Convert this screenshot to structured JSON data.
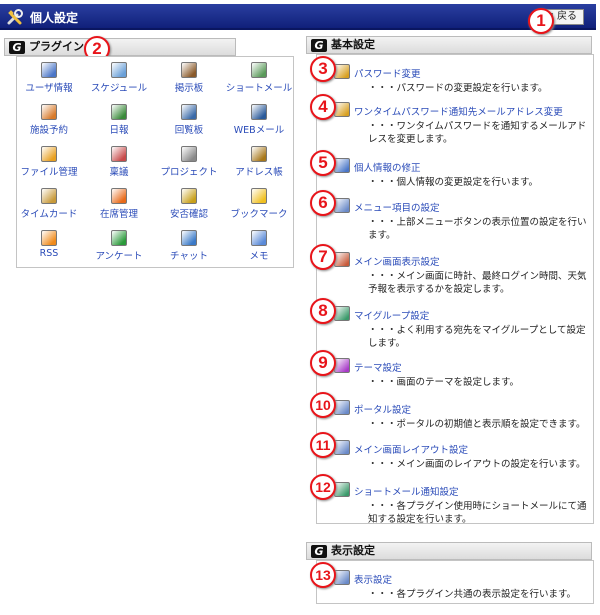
{
  "header": {
    "title": "個人設定",
    "back_label": "戻る"
  },
  "plugin_section": {
    "title": "プラグイン"
  },
  "plugins": [
    {
      "label": "ユーザ情報",
      "icon": "user-info-icon",
      "color": "#4a76c8"
    },
    {
      "label": "スケジュール",
      "icon": "schedule-icon",
      "color": "#6aa0d8"
    },
    {
      "label": "掲示板",
      "icon": "bulletin-board-icon",
      "color": "#8a5a2a"
    },
    {
      "label": "ショートメール",
      "icon": "short-mail-icon",
      "color": "#5a9a5a"
    },
    {
      "label": "施設予約",
      "icon": "facility-icon",
      "color": "#d87a2a"
    },
    {
      "label": "日報",
      "icon": "daily-report-icon",
      "color": "#3a8a3a"
    },
    {
      "label": "回覧板",
      "icon": "circular-icon",
      "color": "#3a6aa8"
    },
    {
      "label": "WEBメール",
      "icon": "webmail-icon",
      "color": "#2a5a9a"
    },
    {
      "label": "ファイル管理",
      "icon": "folder-icon",
      "color": "#e8a020"
    },
    {
      "label": "稟議",
      "icon": "approval-icon",
      "color": "#c84a4a"
    },
    {
      "label": "プロジェクト",
      "icon": "project-icon",
      "color": "#888888"
    },
    {
      "label": "アドレス帳",
      "icon": "address-book-icon",
      "color": "#a8781a"
    },
    {
      "label": "タイムカード",
      "icon": "clock-icon",
      "color": "#c89a3a"
    },
    {
      "label": "在席管理",
      "icon": "presence-icon",
      "color": "#e86a1a"
    },
    {
      "label": "安否確認",
      "icon": "safety-icon",
      "color": "#c8a01a"
    },
    {
      "label": "ブックマーク",
      "icon": "bookmark-star-icon",
      "color": "#f0c020"
    },
    {
      "label": "RSS",
      "icon": "rss-icon",
      "color": "#f08a1a"
    },
    {
      "label": "アンケート",
      "icon": "survey-check-icon",
      "color": "#2a9a3a"
    },
    {
      "label": "チャット",
      "icon": "chat-icon",
      "color": "#3a7ac8"
    },
    {
      "label": "メモ",
      "icon": "memo-icon",
      "color": "#5a8ad8"
    }
  ],
  "basic_section": {
    "title": "基本設定"
  },
  "basic_items": [
    {
      "number": "3",
      "label": "パスワード変更",
      "desc": "・・・パスワードの変更設定を行います。",
      "icon": "lock-icon",
      "color": "#d8a020"
    },
    {
      "number": "4",
      "label": "ワンタイムパスワード通知先メールアドレス変更",
      "desc": "・・・ワンタイムパスワードを通知するメールアドレスを変更します。",
      "icon": "lock-mail-icon",
      "color": "#d8a020"
    },
    {
      "number": "5",
      "label": "個人情報の修正",
      "desc": "・・・個人情報の変更設定を行います。",
      "icon": "user-edit-icon",
      "color": "#4a76c8"
    },
    {
      "number": "6",
      "label": "メニュー項目の設定",
      "desc": "・・・上部メニューボタンの表示位置の設定を行います。",
      "icon": "menu-settings-icon",
      "color": "#6a8ac8"
    },
    {
      "number": "7",
      "label": "メイン画面表示設定",
      "desc": "・・・メイン画面に時計、最終ログイン時間、天気予報を表示するかを設定します。",
      "icon": "main-display-icon",
      "color": "#c85a3a"
    },
    {
      "number": "8",
      "label": "マイグループ設定",
      "desc": "・・・よく利用する宛先をマイグループとして設定します。",
      "icon": "my-group-icon",
      "color": "#3a9a6a"
    },
    {
      "number": "9",
      "label": "テーマ設定",
      "desc": "・・・画面のテーマを設定します。",
      "icon": "theme-icon",
      "color": "#a83ac8"
    },
    {
      "number": "10",
      "label": "ポータル設定",
      "desc": "・・・ポータルの初期値と表示順を設定できます。",
      "icon": "portal-icon",
      "color": "#6a8ac8"
    },
    {
      "number": "11",
      "label": "メイン画面レイアウト設定",
      "desc": "・・・メイン画面のレイアウトの設定を行います。",
      "icon": "layout-icon",
      "color": "#6a8ac8"
    },
    {
      "number": "12",
      "label": "ショートメール通知設定",
      "desc": "・・・各プラグイン使用時にショートメールにて通知する設定を行います。",
      "icon": "mail-notify-icon",
      "color": "#3a9a6a"
    }
  ],
  "display_section": {
    "title": "表示設定"
  },
  "display_items": [
    {
      "number": "13",
      "label": "表示設定",
      "desc": "・・・各プラグイン共通の表示設定を行います。",
      "icon": "display-settings-icon",
      "color": "#6a8ac8"
    }
  ],
  "markers": {
    "back": "1",
    "plugins": "2"
  },
  "colors": {
    "title_bar": "#1a2c90",
    "link": "#2a4bb8",
    "number_badge": "#e8141a"
  }
}
